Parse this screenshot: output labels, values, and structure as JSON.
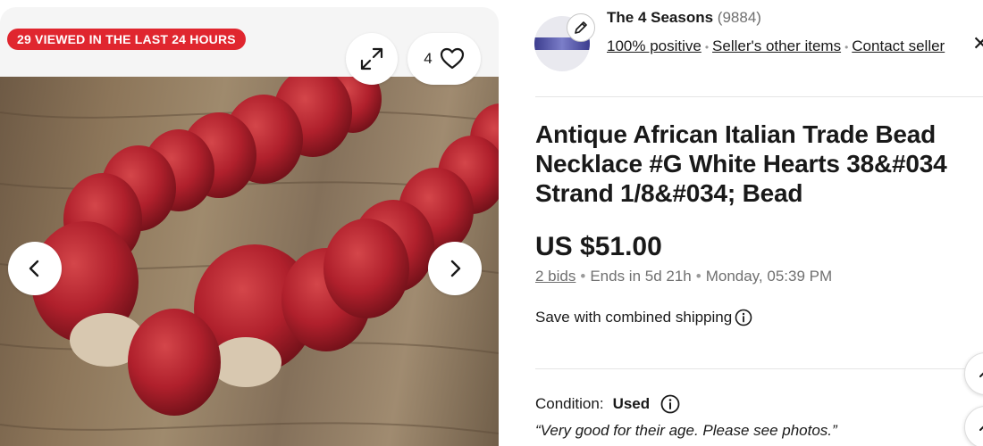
{
  "gallery": {
    "viewed_badge": "29 VIEWED IN THE LAST 24 HOURS",
    "watch_count": "4",
    "icons": [
      "expand-icon",
      "heart-icon",
      "chevron-left-icon",
      "chevron-right-icon"
    ]
  },
  "seller": {
    "name": "The 4 Seasons",
    "feedback_count": "(9884)",
    "positive": "100% positive",
    "other_items": "Seller's other items",
    "contact": "Contact seller",
    "close": "✕"
  },
  "listing": {
    "title": "Antique African Italian Trade Bead Necklace #G White Hearts 38&#034 Strand 1/8&#034; Bead",
    "price": "US $51.00",
    "bids": "2 bids",
    "ends_in": "Ends in 5d 21h",
    "end_date": "Monday, 05:39 PM",
    "shipping": "Save with combined shipping",
    "condition_label": "Condition:",
    "condition_value": "Used",
    "condition_note": "“Very good for their age. Please see photos.”"
  },
  "colors": {
    "badge": "#e0262f",
    "bead": "#b0202c",
    "text": "#191919",
    "muted": "#707070"
  }
}
